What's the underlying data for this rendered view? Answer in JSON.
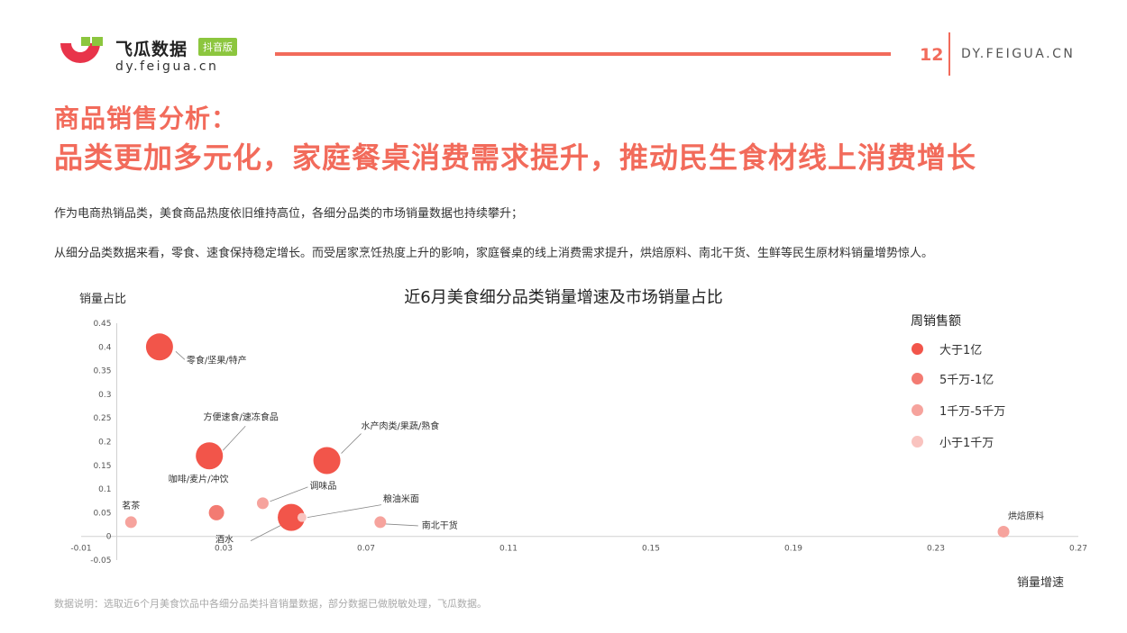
{
  "brand": {
    "name": "飞瓜数据",
    "badge": "抖音版",
    "url": "dy.feigua.cn"
  },
  "header": {
    "page_number": "12",
    "site": "DY.FEIGUA.CN"
  },
  "title": {
    "line1": "商品销售分析：",
    "line2": "品类更加多元化，家庭餐桌消费需求提升，推动民生食材线上消费增长"
  },
  "paragraphs": {
    "p1": "作为电商热销品类，美食商品热度依旧维持高位，各细分品类的市场销量数据也持续攀升；",
    "p2": "从细分品类数据来看，零食、速食保持稳定增长。而受居家烹饪热度上升的影响，家庭餐桌的线上消费需求提升，烘焙原料、南北干货、生鲜等民生原材料销量增势惊人。"
  },
  "footnote": "数据说明：选取近6个月美食饮品中各细分品类抖音销量数据，部分数据已做脱敏处理，飞瓜数据。",
  "colors": {
    "accent": "#f26b5b",
    "brand_green": "#8cc63e",
    "tier_1": "#f2554a",
    "tier_2": "#f37b72",
    "tier_3": "#f6a39d",
    "tier_4": "#f9c3bf"
  },
  "chart_data": {
    "type": "scatter",
    "title": "近6月美食细分品类销量增速及市场销量占比",
    "xlabel": "销量增速",
    "ylabel": "销量占比",
    "xlim": [
      -0.01,
      0.27
    ],
    "ylim": [
      -0.05,
      0.45
    ],
    "x_ticks": [
      "-0.01",
      "0.03",
      "0.07",
      "0.11",
      "0.15",
      "0.19",
      "0.23",
      "0.27"
    ],
    "y_ticks": [
      "-0.05",
      "0",
      "0.05",
      "0.1",
      "0.15",
      "0.2",
      "0.25",
      "0.3",
      "0.35",
      "0.4",
      "0.45"
    ],
    "x_tick_values": [
      -0.01,
      0.03,
      0.07,
      0.11,
      0.15,
      0.19,
      0.23,
      0.27
    ],
    "y_tick_values": [
      -0.05,
      0,
      0.05,
      0.1,
      0.15,
      0.2,
      0.25,
      0.3,
      0.35,
      0.4,
      0.45
    ],
    "legend": {
      "title": "周销售额",
      "position": "right",
      "tiers": [
        "大于1亿",
        "5千万-1亿",
        "1千万-5千万",
        "小于1千万"
      ]
    },
    "points": [
      {
        "name": "零食/坚果/特产",
        "x": 0.012,
        "y": 0.4,
        "tier": 0
      },
      {
        "name": "方便速食/速冻食品",
        "x": 0.026,
        "y": 0.17,
        "tier": 0
      },
      {
        "name": "水产肉类/果蔬/熟食",
        "x": 0.059,
        "y": 0.16,
        "tier": 0
      },
      {
        "name": "咖啡/麦片/冲饮",
        "x": 0.028,
        "y": 0.05,
        "tier": 1
      },
      {
        "name": "茗茶",
        "x": 0.004,
        "y": 0.03,
        "tier": 2
      },
      {
        "name": "调味品",
        "x": 0.041,
        "y": 0.07,
        "tier": 2
      },
      {
        "name": "酒水",
        "x": 0.049,
        "y": 0.04,
        "tier": 0
      },
      {
        "name": "粮油米面",
        "x": 0.052,
        "y": 0.04,
        "tier": 3
      },
      {
        "name": "南北干货",
        "x": 0.074,
        "y": 0.03,
        "tier": 2
      },
      {
        "name": "烘焙原料",
        "x": 0.249,
        "y": 0.01,
        "tier": 2
      }
    ]
  }
}
